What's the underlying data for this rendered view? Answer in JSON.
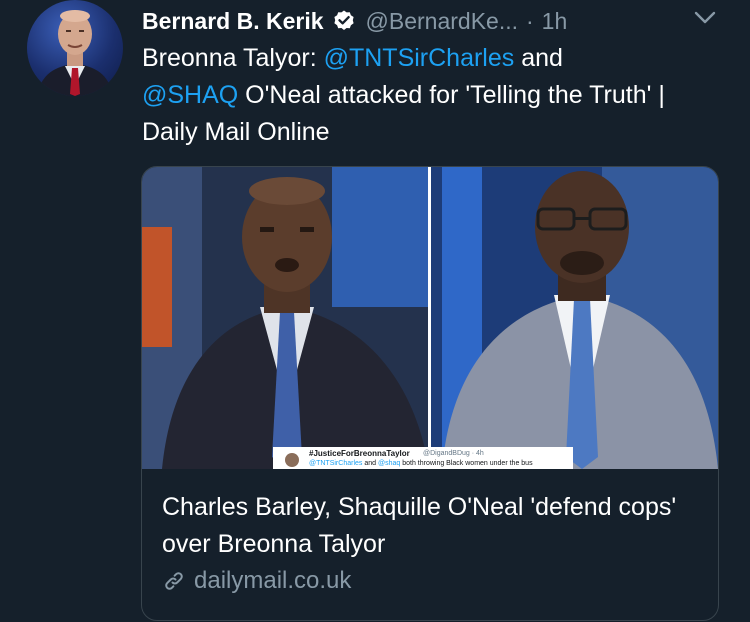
{
  "tweet": {
    "display_name": "Bernard B. Kerik",
    "handle": "@BernardKe...",
    "separator": "·",
    "time": "1h",
    "text_parts": {
      "intro": "Breonna Talyor: ",
      "mention1": "@TNTSirCharles",
      "and": " and",
      "mention2": "@SHAQ",
      "rest": " O'Neal attacked for 'Telling the Truth' | Daily Mail Online"
    }
  },
  "card": {
    "title": "Charles Barley, Shaquille O'Neal 'defend cops' over Breonna Talyor",
    "domain": "dailymail.co.uk",
    "embedded": {
      "name": "#JusticeForBreonnaTaylor",
      "handle": "@DigandBDug · 4h",
      "mention1": "@TNTSirCharles",
      "and": " and ",
      "mention2": "@shaq",
      "body": " both throwing Black women under the bus"
    }
  },
  "icons": {
    "verified": "verified-badge-icon",
    "chevron": "chevron-down-icon",
    "link": "link-icon"
  },
  "colors": {
    "background": "#15202b",
    "mention": "#1da1f2",
    "secondary": "#8899a6",
    "border": "#38444d"
  }
}
